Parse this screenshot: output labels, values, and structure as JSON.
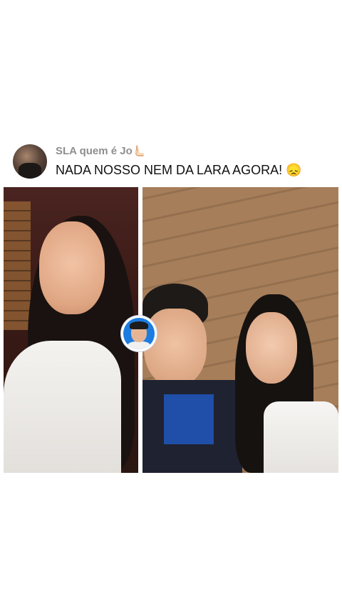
{
  "post": {
    "username": "SLA quem é Jo🫷🏻",
    "caption": "NADA NOSSO NEM DA LARA AGORA! 😞"
  }
}
